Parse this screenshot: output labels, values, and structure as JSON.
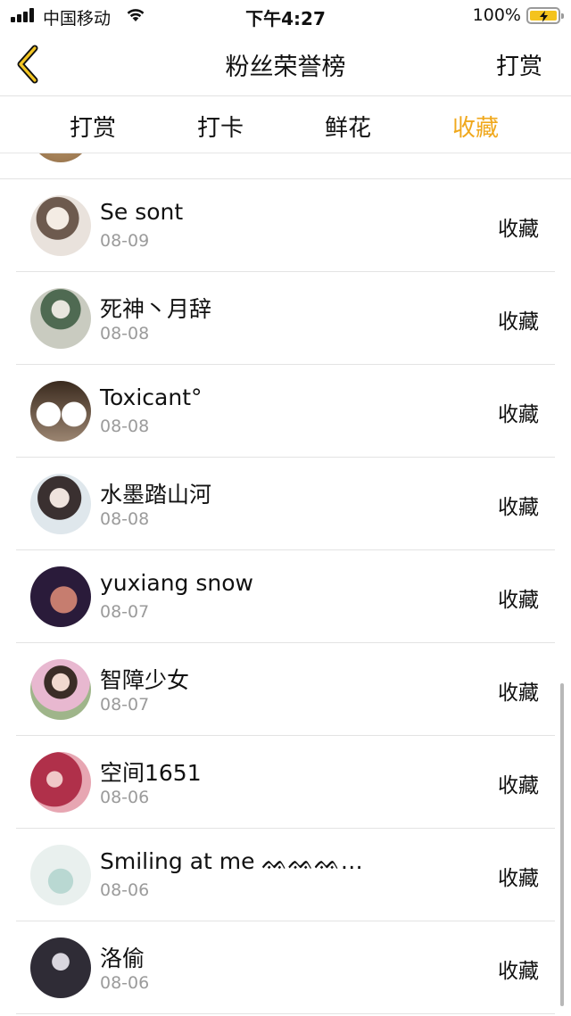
{
  "status_bar": {
    "carrier": "中国移动",
    "time": "下午4:27",
    "battery": "100%"
  },
  "nav": {
    "title": "粉丝荣誉榜",
    "right_action": "打赏",
    "back_icon": "chevron-left-icon"
  },
  "tabs": [
    {
      "label": "打赏",
      "active": false
    },
    {
      "label": "打卡",
      "active": false
    },
    {
      "label": "鲜花",
      "active": false
    },
    {
      "label": "收藏",
      "active": true
    }
  ],
  "colors": {
    "accent": "#f0a81c",
    "date_gray": "#9b9b9b",
    "divider": "#e3e3e3"
  },
  "list": [
    {
      "name": "Se sont",
      "date": "08-09",
      "action": "收藏",
      "avatar": "avatar-girl-hood"
    },
    {
      "name": "死神丶月辞",
      "date": "08-08",
      "action": "收藏",
      "avatar": "avatar-anime-green"
    },
    {
      "name": "Toxicant°",
      "date": "08-08",
      "action": "收藏",
      "avatar": "avatar-white-dogs"
    },
    {
      "name": "水墨踏山河",
      "date": "08-08",
      "action": "收藏",
      "avatar": "avatar-girl-longhair"
    },
    {
      "name": "yuxiang snow",
      "date": "08-07",
      "action": "收藏",
      "avatar": "avatar-man-selfie"
    },
    {
      "name": "智障少女",
      "date": "08-07",
      "action": "收藏",
      "avatar": "avatar-girl-pink"
    },
    {
      "name": "空间1651",
      "date": "08-06",
      "action": "收藏",
      "avatar": "avatar-red-scene"
    },
    {
      "name": "Smiling at me ᨐᨐᨐ…",
      "date": "08-06",
      "action": "收藏",
      "avatar": "avatar-girl-teal"
    },
    {
      "name": "洛偷",
      "date": "08-06",
      "action": "收藏",
      "avatar": "avatar-dark-anime"
    }
  ]
}
